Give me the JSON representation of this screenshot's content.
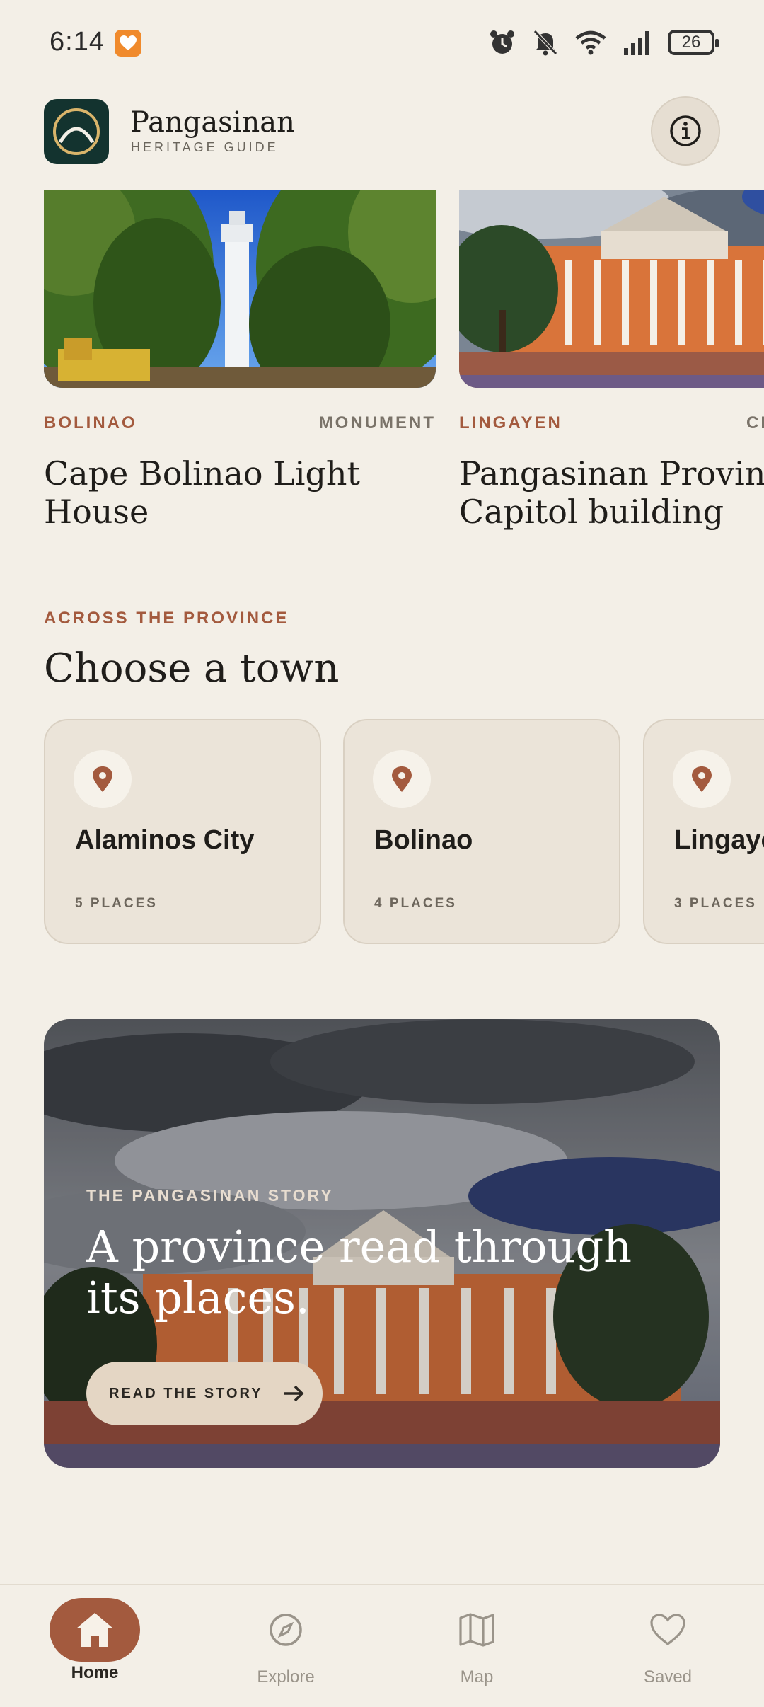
{
  "status_bar": {
    "time": "6:14",
    "battery": "26",
    "icons": [
      "alarm-icon",
      "mute-icon",
      "wifi-icon",
      "signal-icon",
      "battery-icon"
    ]
  },
  "header": {
    "brand_name": "Pangasinan",
    "brand_sub": "HERITAGE GUIDE",
    "info_icon": "info-icon"
  },
  "featured": [
    {
      "town": "BOLINAO",
      "category": "MONUMENT",
      "title": "Cape Bolinao Light House"
    },
    {
      "town": "LINGAYEN",
      "category": "CI",
      "title": "Pangasinan Provincial Capitol building"
    }
  ],
  "towns_section": {
    "eyebrow": "ACROSS THE PROVINCE",
    "title": "Choose a town",
    "towns": [
      {
        "name": "Alaminos City",
        "count": "5 PLACES"
      },
      {
        "name": "Bolinao",
        "count": "4 PLACES"
      },
      {
        "name": "Lingayen",
        "count": "3 PLACES"
      }
    ]
  },
  "story": {
    "eyebrow": "THE PANGASINAN STORY",
    "title": "A province read through its places.",
    "button_label": "READ THE STORY"
  },
  "nav": [
    {
      "label": "Home",
      "icon": "home-icon",
      "active": true
    },
    {
      "label": "Explore",
      "icon": "compass-icon",
      "active": false
    },
    {
      "label": "Map",
      "icon": "map-icon",
      "active": false
    },
    {
      "label": "Saved",
      "icon": "heart-icon",
      "active": false
    }
  ],
  "colors": {
    "background": "#f3efe7",
    "accent": "#a35a3e",
    "logo_bg": "#13332f",
    "card_bg": "#ebe4d9"
  }
}
